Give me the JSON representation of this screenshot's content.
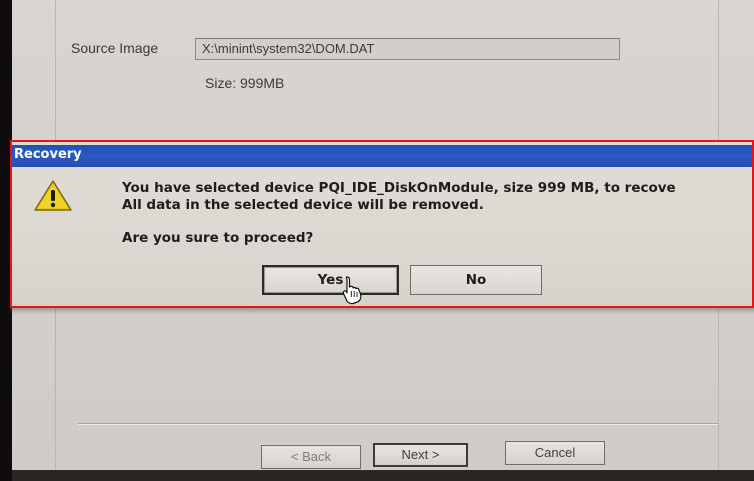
{
  "wizard": {
    "source_label": "Source Image",
    "source_value": "X:\\minint\\system32\\DOM.DAT",
    "size_text": "Size: 999MB",
    "buttons": {
      "back": "< Back",
      "next": "Next >",
      "cancel": "Cancel"
    }
  },
  "dialog": {
    "title": "Recovery",
    "message_line1": "You have selected device PQI_IDE_DiskOnModule, size 999 MB, to recove",
    "message_line2": "All data in the selected device will be removed.",
    "question": "Are you sure to proceed?",
    "yes_label": "Yes",
    "no_label": "No",
    "icon": "warning-icon",
    "titlebar_color": "#2450b3",
    "highlight_color": "#e8141a"
  }
}
